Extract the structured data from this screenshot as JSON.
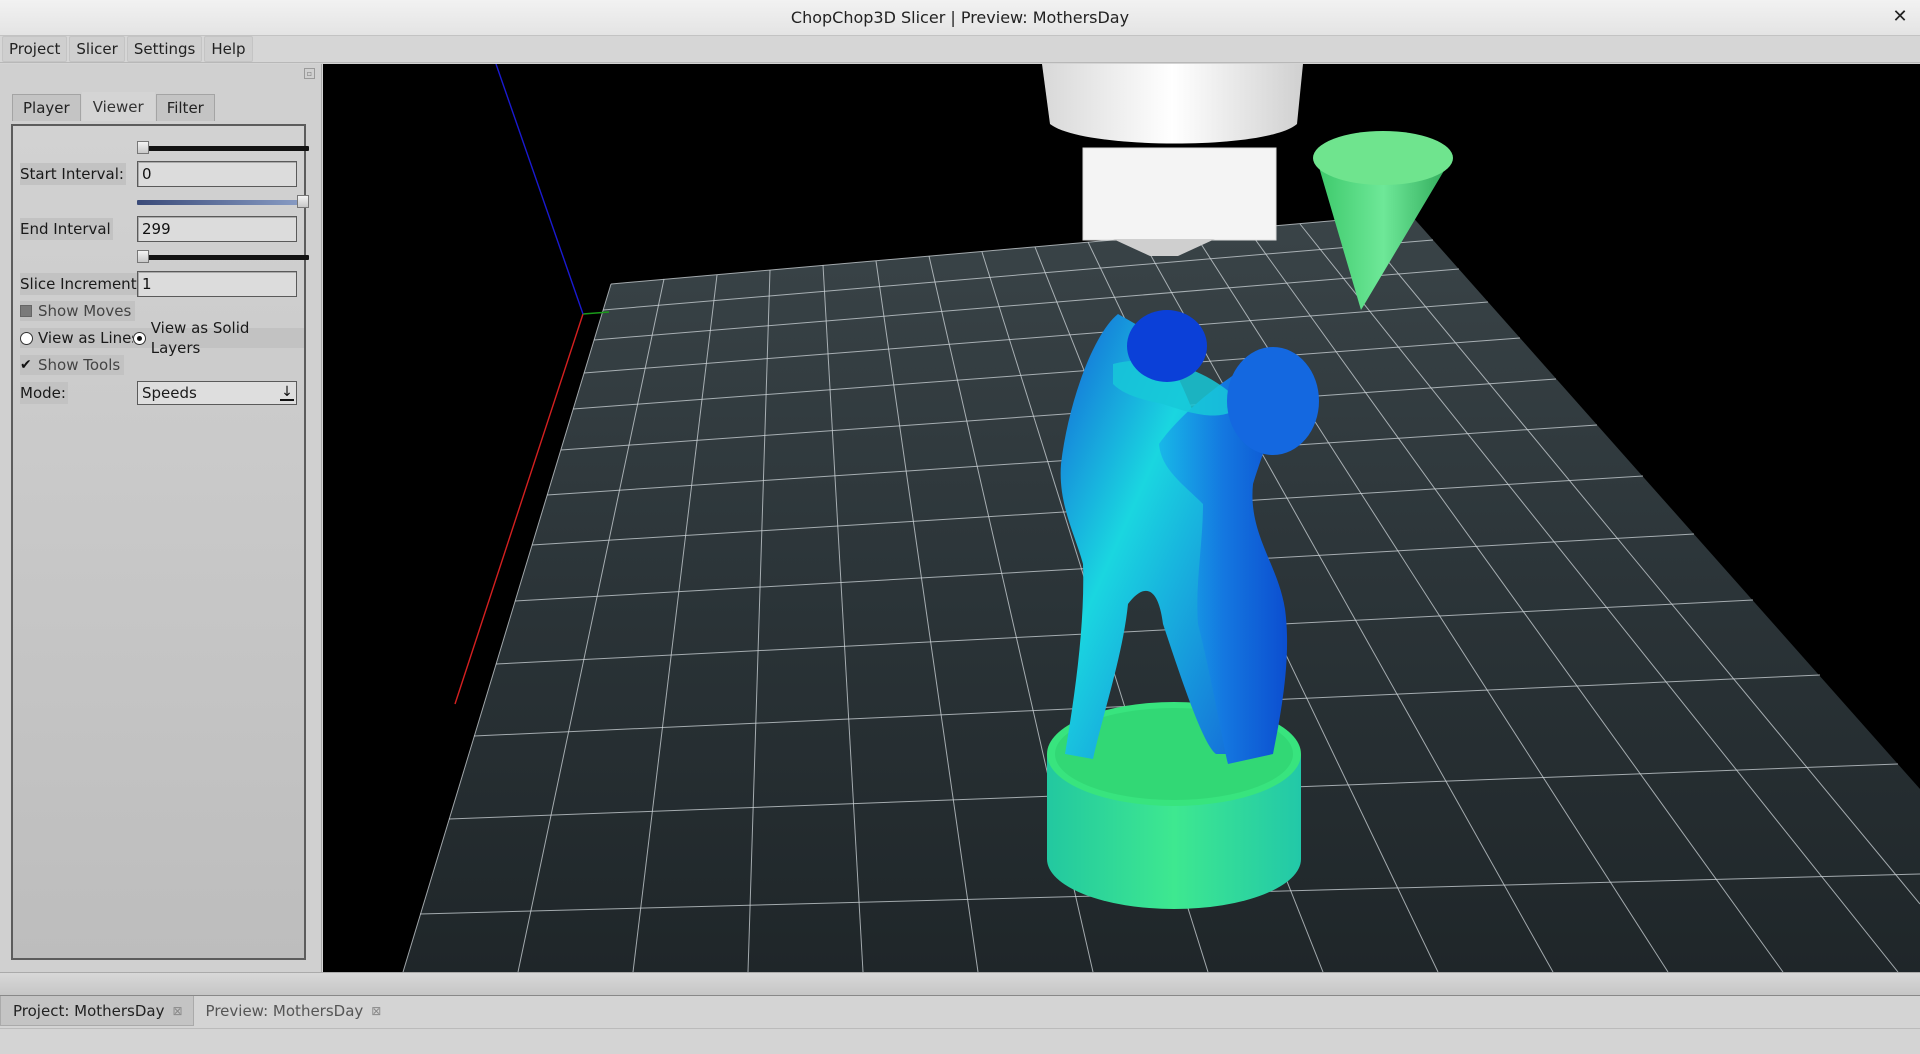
{
  "window": {
    "title": "ChopChop3D Slicer | Preview: MothersDay",
    "close_glyph": "✕"
  },
  "menubar": {
    "items": [
      {
        "label": "Project"
      },
      {
        "label": "Slicer"
      },
      {
        "label": "Settings"
      },
      {
        "label": "Help"
      }
    ]
  },
  "side_panel": {
    "tabs": [
      {
        "label": "Player",
        "active": false
      },
      {
        "label": "Viewer",
        "active": true
      },
      {
        "label": "Filter",
        "active": false
      }
    ],
    "start_interval": {
      "label": "Start Interval:",
      "value": "0",
      "slider_fraction": 0.0
    },
    "end_interval": {
      "label": "End Interval",
      "value": "299",
      "slider_fraction": 1.0
    },
    "slice_increment": {
      "label": "Slice Increment:",
      "value": "1",
      "slider_fraction": 0.0
    },
    "show_moves": {
      "label": "Show Moves",
      "checked": false
    },
    "view_mode": {
      "lines_label": "View as Lines",
      "solid_label": "View as Solid Layers",
      "selected": "solid"
    },
    "show_tools": {
      "label": "Show Tools",
      "checked": true,
      "glyph": "✔"
    },
    "mode": {
      "label": "Mode:",
      "selected": "Speeds",
      "arrow_icon": "down-arrow-icon"
    }
  },
  "viewport": {
    "background": "#000000",
    "bed_color": "#2a3338",
    "grid_color": "#cfd6da",
    "axis_colors": {
      "x": "#d42020",
      "y": "#1a9a1a",
      "z": "#1a1ad0"
    },
    "model_colors": {
      "base": "#34e090",
      "figure_cyan": "#1ad6e0",
      "figure_blue": "#1262d8",
      "head": "#0a3cd8"
    },
    "tool_color": "#5ae08a",
    "extruder_color": "#f0f0f0"
  },
  "document_tabs": [
    {
      "label": "Project: MothersDay",
      "active": true
    },
    {
      "label": "Preview: MothersDay",
      "active": false
    }
  ],
  "icons": {
    "tab_close": "⊠"
  }
}
